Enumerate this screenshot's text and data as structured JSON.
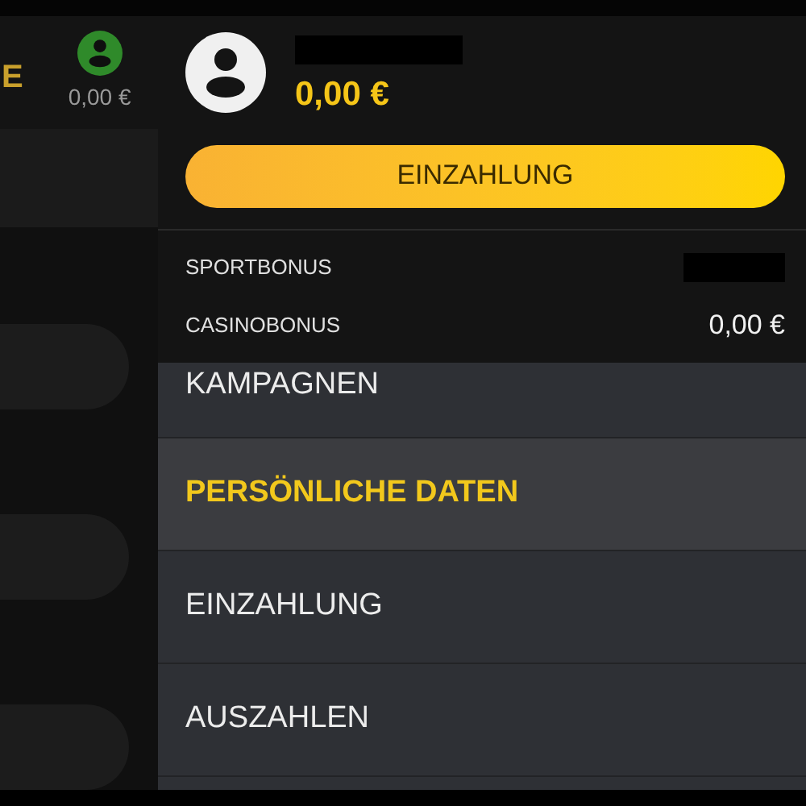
{
  "background": {
    "brand_fragment": "E",
    "balance": "0,00 €"
  },
  "account": {
    "balance": "0,00 €",
    "deposit_button": "EINZAHLUNG"
  },
  "bonuses": [
    {
      "label": "SPORTBONUS",
      "redacted": true
    },
    {
      "label": "CASINOBONUS",
      "value": "0,00 €",
      "redacted": false
    }
  ],
  "menu": [
    {
      "label": "KAMPAGNEN",
      "selected": false
    },
    {
      "label": "PERSÖNLICHE DATEN",
      "selected": true
    },
    {
      "label": "EINZAHLUNG",
      "selected": false
    },
    {
      "label": "AUSZAHLEN",
      "selected": false
    }
  ]
}
